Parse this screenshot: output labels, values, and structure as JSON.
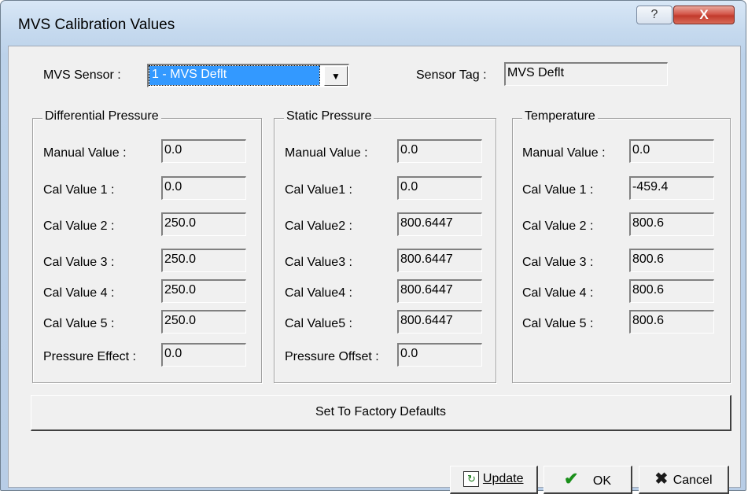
{
  "window": {
    "title": "MVS Calibration Values",
    "help_glyph": "?",
    "close_glyph": "X"
  },
  "sensor": {
    "label": "MVS Sensor :",
    "selected": "1 - MVS Deflt",
    "tag_label": "Sensor Tag :",
    "tag_value": "MVS Deflt"
  },
  "groups": [
    {
      "title": "Differential Pressure",
      "rows": [
        {
          "label": "Manual Value :",
          "value": "0.0"
        },
        {
          "label": "Cal Value 1 :",
          "value": "0.0"
        },
        {
          "label": "Cal Value 2 :",
          "value": "250.0"
        },
        {
          "label": "Cal Value 3 :",
          "value": "250.0"
        },
        {
          "label": "Cal Value 4 :",
          "value": "250.0"
        },
        {
          "label": "Cal Value 5 :",
          "value": "250.0"
        },
        {
          "label": "Pressure Effect :",
          "value": "0.0"
        }
      ]
    },
    {
      "title": "Static Pressure",
      "rows": [
        {
          "label": "Manual Value :",
          "value": "0.0"
        },
        {
          "label": "Cal Value1 :",
          "value": "0.0"
        },
        {
          "label": "Cal Value2 :",
          "value": "800.6447"
        },
        {
          "label": "Cal Value3 :",
          "value": "800.6447"
        },
        {
          "label": "Cal Value4 :",
          "value": "800.6447"
        },
        {
          "label": "Cal Value5 :",
          "value": "800.6447"
        },
        {
          "label": "Pressure Offset :",
          "value": "0.0"
        }
      ]
    },
    {
      "title": "Temperature",
      "rows": [
        {
          "label": "Manual Value :",
          "value": "0.0"
        },
        {
          "label": "Cal Value 1 :",
          "value": "-459.4"
        },
        {
          "label": "Cal Value 2 :",
          "value": "800.6"
        },
        {
          "label": "Cal Value 3 :",
          "value": "800.6"
        },
        {
          "label": "Cal Value 4 :",
          "value": "800.6"
        },
        {
          "label": "Cal Value 5 :",
          "value": "800.6"
        }
      ]
    }
  ],
  "buttons": {
    "factory": "Set To Factory Defaults",
    "update": "Update",
    "ok": "OK",
    "cancel": "Cancel"
  },
  "icons": {
    "update": "refresh-icon",
    "ok": "checkmark-icon",
    "cancel": "x-icon"
  }
}
